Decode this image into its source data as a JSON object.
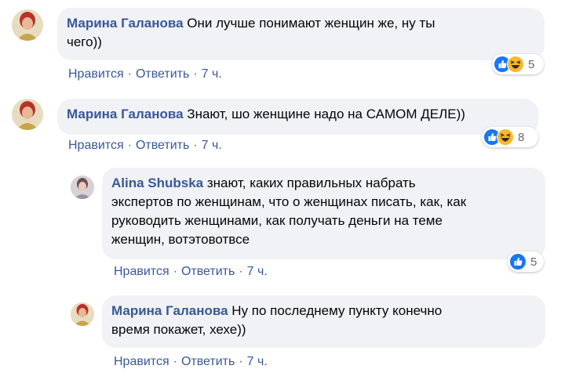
{
  "comments": [
    {
      "author": "Марина Галанова",
      "text_lines": [
        "Они лучше понимают женщин же, ну ты",
        "чего))"
      ],
      "reaction_count": "5",
      "reactions": [
        "like-icon",
        "haha-icon"
      ],
      "actions": {
        "like": "Нравится",
        "reply": "Ответить",
        "time": "7 ч."
      }
    },
    {
      "author": "Марина Галанова",
      "text_lines": [
        "Знают, шо женщине надо на САМОМ ДЕЛЕ))"
      ],
      "reaction_count": "8",
      "reactions": [
        "like-icon",
        "haha-icon"
      ],
      "actions": {
        "like": "Нравится",
        "reply": "Ответить",
        "time": "7 ч."
      }
    },
    {
      "author": "Alina Shubska",
      "text_lines": [
        "знают, каких правильных набрать",
        "экспертов по женщинам, что о женщинах писать, как, как",
        "руководить женщинами, как получать деньги на теме",
        "женщин, вотэтовотвсе"
      ],
      "reaction_count": "5",
      "reactions": [
        "like-icon"
      ],
      "actions": {
        "like": "Нравится",
        "reply": "Ответить",
        "time": "7 ч."
      }
    },
    {
      "author": "Марина Галанова",
      "text_lines": [
        "Ну по последнему пункту конечно",
        "время покажет, хехе))"
      ],
      "actions": {
        "like": "Нравится",
        "reply": "Ответить",
        "time": "7 ч."
      }
    }
  ],
  "separator": "·",
  "colors": {
    "author": "#385898",
    "bubble_bg": "#f0f2f5",
    "meta": "#65676b",
    "like_blue": "#1877f2",
    "haha_yellow": "#f7b928"
  }
}
